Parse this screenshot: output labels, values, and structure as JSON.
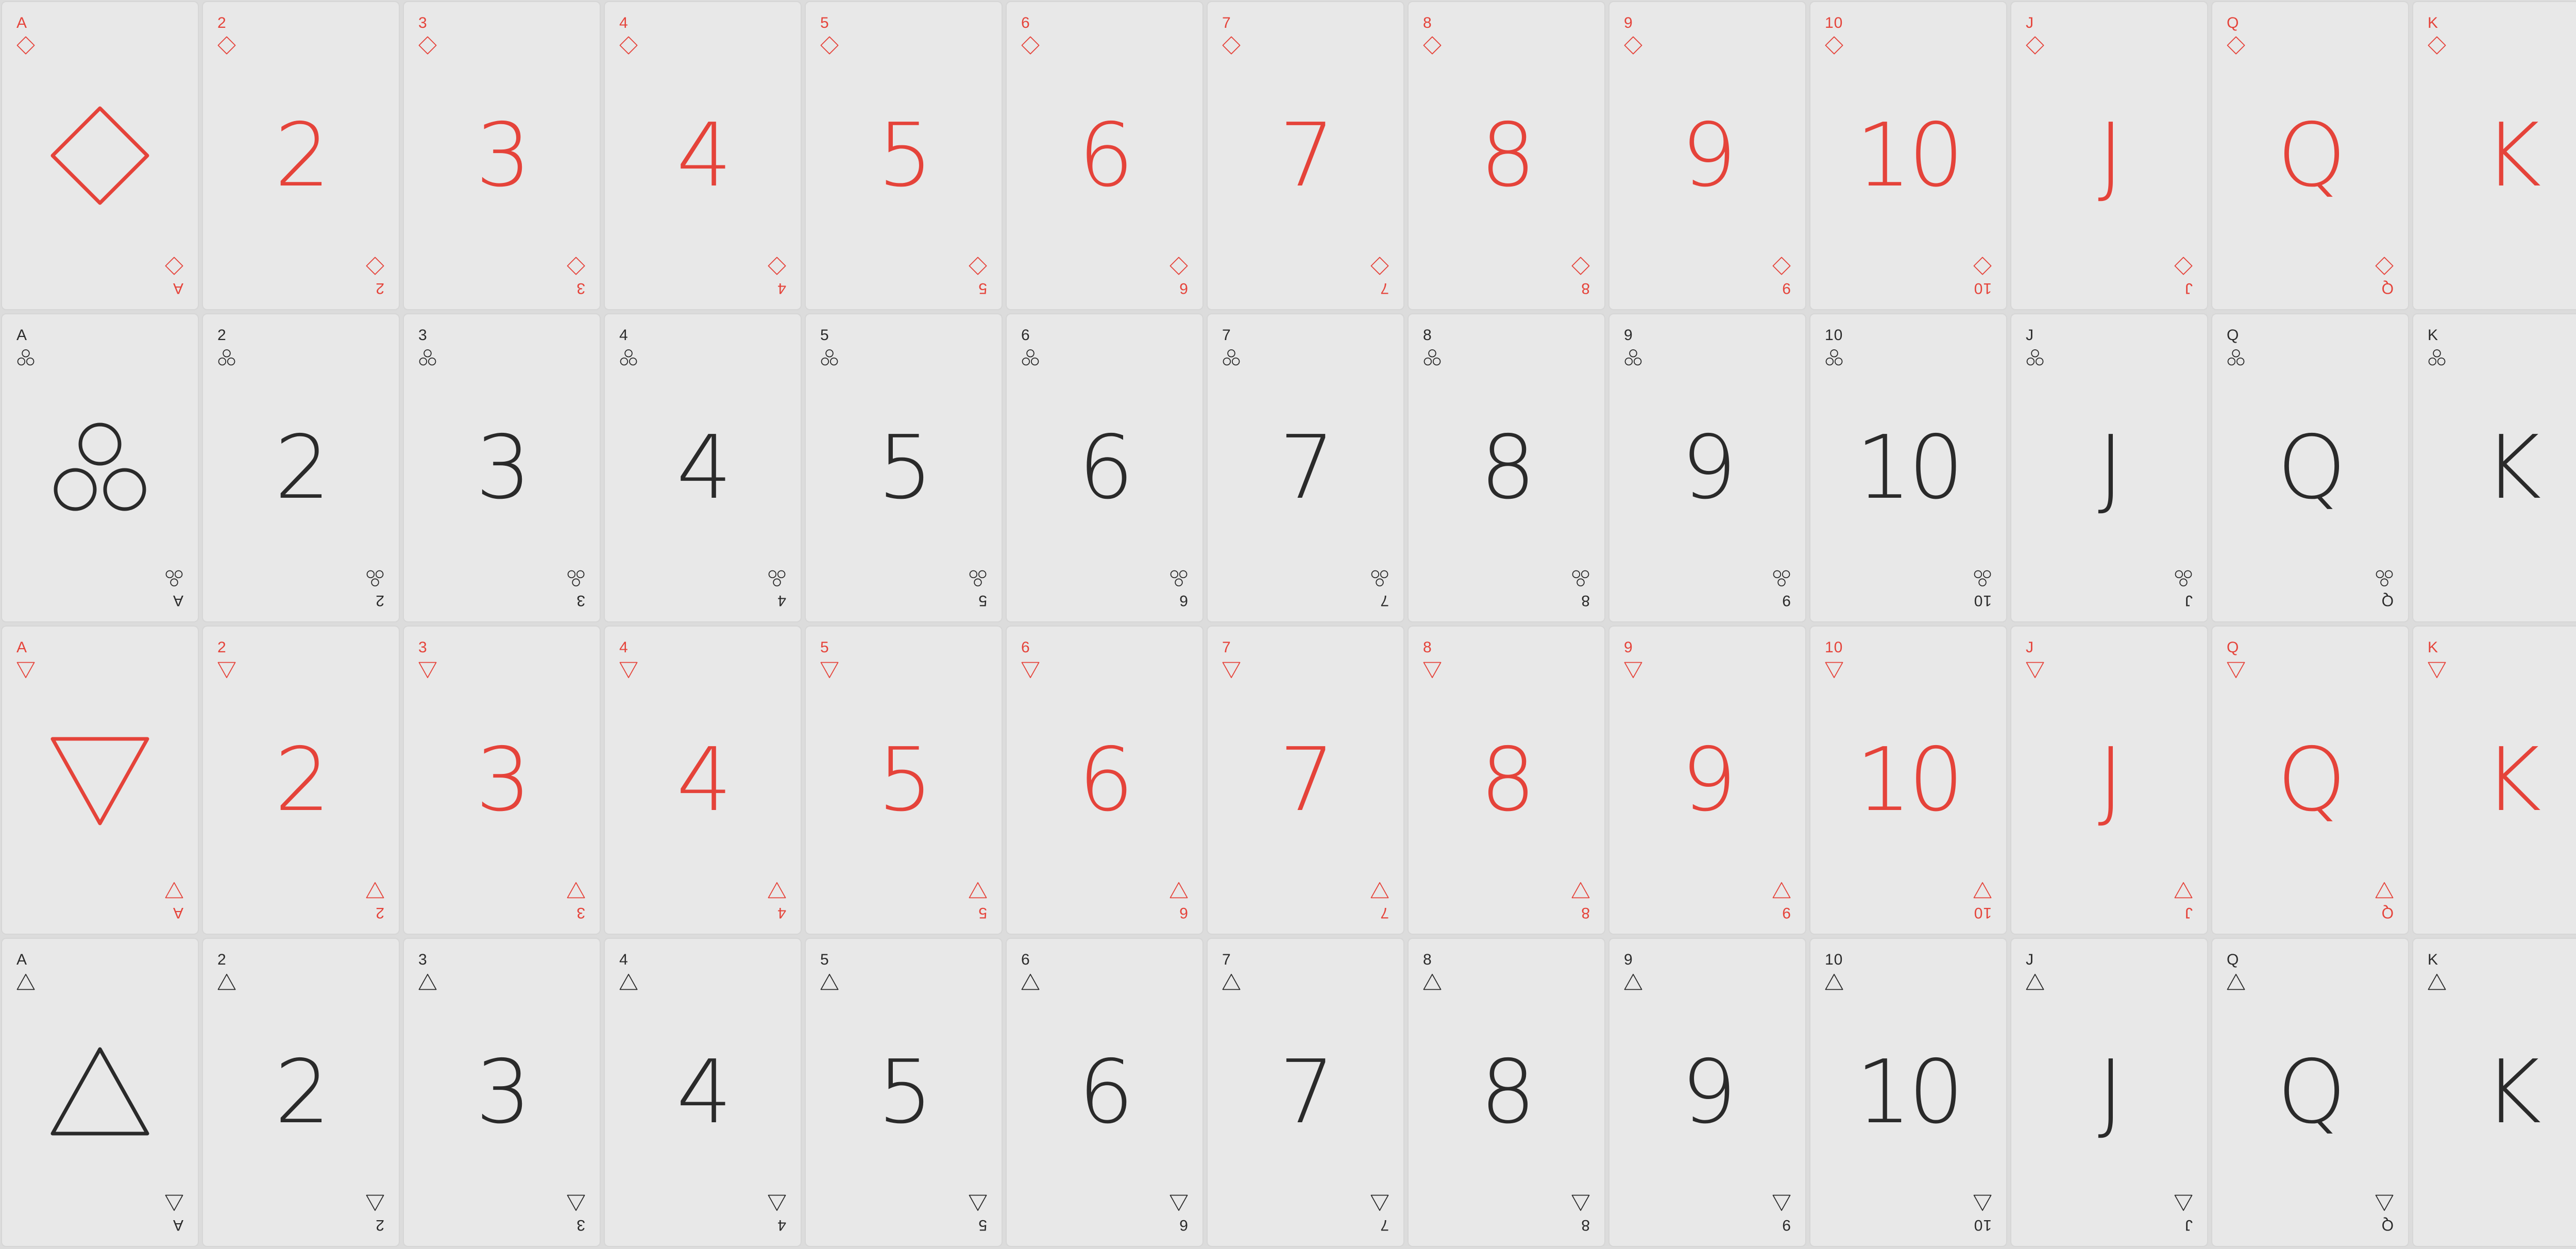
{
  "ranks": [
    "A",
    "2",
    "3",
    "4",
    "5",
    "6",
    "7",
    "8",
    "9",
    "10",
    "J",
    "Q",
    "K"
  ],
  "suits": [
    {
      "name": "diamond",
      "icon": "diamond-outline-icon",
      "color": "#e5433a",
      "tone": "red"
    },
    {
      "name": "club",
      "icon": "three-circles-icon",
      "color": "#2a2a2a",
      "tone": "black"
    },
    {
      "name": "heart",
      "icon": "triangle-down-icon",
      "color": "#e5433a",
      "tone": "red"
    },
    {
      "name": "spade",
      "icon": "triangle-up-icon",
      "color": "#2a2a2a",
      "tone": "black"
    }
  ],
  "cards": [
    {
      "suit": "diamond",
      "rank": "A"
    },
    {
      "suit": "diamond",
      "rank": "2"
    },
    {
      "suit": "diamond",
      "rank": "3"
    },
    {
      "suit": "diamond",
      "rank": "4"
    },
    {
      "suit": "diamond",
      "rank": "5"
    },
    {
      "suit": "diamond",
      "rank": "6"
    },
    {
      "suit": "diamond",
      "rank": "7"
    },
    {
      "suit": "diamond",
      "rank": "8"
    },
    {
      "suit": "diamond",
      "rank": "9"
    },
    {
      "suit": "diamond",
      "rank": "10"
    },
    {
      "suit": "diamond",
      "rank": "J"
    },
    {
      "suit": "diamond",
      "rank": "Q"
    },
    {
      "suit": "diamond",
      "rank": "K"
    },
    {
      "suit": "club",
      "rank": "A"
    },
    {
      "suit": "club",
      "rank": "2"
    },
    {
      "suit": "club",
      "rank": "3"
    },
    {
      "suit": "club",
      "rank": "4"
    },
    {
      "suit": "club",
      "rank": "5"
    },
    {
      "suit": "club",
      "rank": "6"
    },
    {
      "suit": "club",
      "rank": "7"
    },
    {
      "suit": "club",
      "rank": "8"
    },
    {
      "suit": "club",
      "rank": "9"
    },
    {
      "suit": "club",
      "rank": "10"
    },
    {
      "suit": "club",
      "rank": "J"
    },
    {
      "suit": "club",
      "rank": "Q"
    },
    {
      "suit": "club",
      "rank": "K"
    },
    {
      "suit": "heart",
      "rank": "A"
    },
    {
      "suit": "heart",
      "rank": "2"
    },
    {
      "suit": "heart",
      "rank": "3"
    },
    {
      "suit": "heart",
      "rank": "4"
    },
    {
      "suit": "heart",
      "rank": "5"
    },
    {
      "suit": "heart",
      "rank": "6"
    },
    {
      "suit": "heart",
      "rank": "7"
    },
    {
      "suit": "heart",
      "rank": "8"
    },
    {
      "suit": "heart",
      "rank": "9"
    },
    {
      "suit": "heart",
      "rank": "10"
    },
    {
      "suit": "heart",
      "rank": "J"
    },
    {
      "suit": "heart",
      "rank": "Q"
    },
    {
      "suit": "heart",
      "rank": "K"
    },
    {
      "suit": "spade",
      "rank": "A"
    },
    {
      "suit": "spade",
      "rank": "2"
    },
    {
      "suit": "spade",
      "rank": "3"
    },
    {
      "suit": "spade",
      "rank": "4"
    },
    {
      "suit": "spade",
      "rank": "5"
    },
    {
      "suit": "spade",
      "rank": "6"
    },
    {
      "suit": "spade",
      "rank": "7"
    },
    {
      "suit": "spade",
      "rank": "8"
    },
    {
      "suit": "spade",
      "rank": "9"
    },
    {
      "suit": "spade",
      "rank": "10"
    },
    {
      "suit": "spade",
      "rank": "J"
    },
    {
      "suit": "spade",
      "rank": "Q"
    },
    {
      "suit": "spade",
      "rank": "K"
    }
  ]
}
